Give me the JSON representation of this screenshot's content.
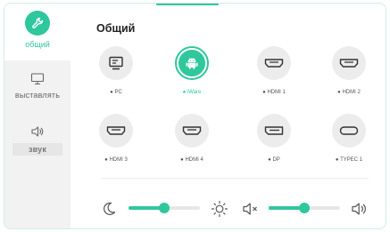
{
  "colors": {
    "accent": "#2fc79c",
    "sidebar_bg": "#f2f2f2",
    "icon_bg": "#ececec"
  },
  "sidebar": {
    "items": [
      {
        "label": "общий",
        "icon": "wrench-icon",
        "active": true
      },
      {
        "label": "выставлять",
        "icon": "monitor-icon",
        "active": false
      },
      {
        "label": "звук",
        "icon": "speaker-icon",
        "active": false
      }
    ]
  },
  "main": {
    "title": "Общий",
    "sources": [
      {
        "label": "PC",
        "icon": "pc-icon"
      },
      {
        "label": "iWare",
        "icon": "android-icon",
        "active": true
      },
      {
        "label": "HDMI 1",
        "icon": "hdmi-icon"
      },
      {
        "label": "HDMI 2",
        "icon": "hdmi-icon"
      },
      {
        "label": "HDMI 3",
        "icon": "hdmi-icon"
      },
      {
        "label": "HDMI 4",
        "icon": "hdmi-icon"
      },
      {
        "label": "DP",
        "icon": "dp-icon"
      },
      {
        "label": "TYPEC 1",
        "icon": "usb-c-icon"
      }
    ]
  },
  "controls": {
    "brightness_level": 0.5,
    "volume_level": 0.5,
    "icons": [
      "moon-icon",
      "sun-icon",
      "mute-icon",
      "speaker-icon"
    ]
  }
}
